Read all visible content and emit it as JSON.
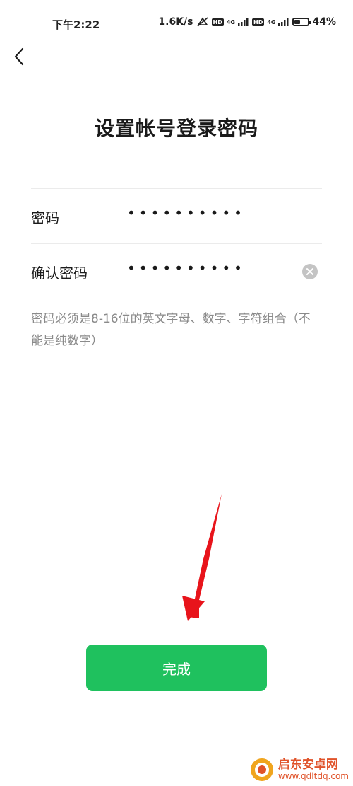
{
  "status_bar": {
    "time": "下午2:22",
    "net_speed": "1.6K/s",
    "hd1": "HD",
    "net1": "4G",
    "hd2": "HD",
    "net2": "4G",
    "battery": "44%",
    "battery_level": 0.44
  },
  "header": {
    "back_icon": "chevron-left-icon"
  },
  "title": "设置帐号登录密码",
  "form": {
    "password_label": "密码",
    "password_value": "••••••••••",
    "confirm_label": "确认密码",
    "confirm_value": "••••••••••",
    "clear_icon": "clear-x-icon"
  },
  "hint": "密码必须是8-16位的英文字母、数字、字符组合（不能是纯数字）",
  "done_label": "完成",
  "watermark": {
    "name": "启东安卓网",
    "url": "www.qdltdq.com"
  },
  "colors": {
    "accent": "#1fc15e",
    "annotation_arrow": "#e8141b"
  }
}
